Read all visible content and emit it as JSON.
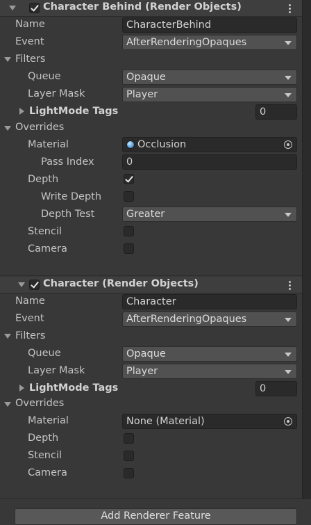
{
  "features": [
    {
      "title": "Character Behind (Render Objects)",
      "enabled": true,
      "name_label": "Name",
      "name_value": "CharacterBehind",
      "event_label": "Event",
      "event_value": "AfterRenderingOpaques",
      "filters_label": "Filters",
      "queue_label": "Queue",
      "queue_value": "Opaque",
      "layer_mask_label": "Layer Mask",
      "layer_mask_value": "Player",
      "lightmode_label": "LightMode Tags",
      "lightmode_value": "0",
      "overrides_label": "Overrides",
      "material_label": "Material",
      "material_value": "Occlusion",
      "pass_index_label": "Pass Index",
      "pass_index_value": "0",
      "depth_label": "Depth",
      "depth_checked": true,
      "write_depth_label": "Write Depth",
      "depth_test_label": "Depth Test",
      "depth_test_value": "Greater",
      "stencil_label": "Stencil",
      "camera_label": "Camera"
    },
    {
      "title": "Character (Render Objects)",
      "enabled": true,
      "name_label": "Name",
      "name_value": "Character",
      "event_label": "Event",
      "event_value": "AfterRenderingOpaques",
      "filters_label": "Filters",
      "queue_label": "Queue",
      "queue_value": "Opaque",
      "layer_mask_label": "Layer Mask",
      "layer_mask_value": "Player",
      "lightmode_label": "LightMode Tags",
      "lightmode_value": "0",
      "overrides_label": "Overrides",
      "material_label": "Material",
      "material_value": "None (Material)",
      "depth_label": "Depth",
      "stencil_label": "Stencil",
      "camera_label": "Camera"
    }
  ],
  "add_button_label": "Add Renderer Feature"
}
